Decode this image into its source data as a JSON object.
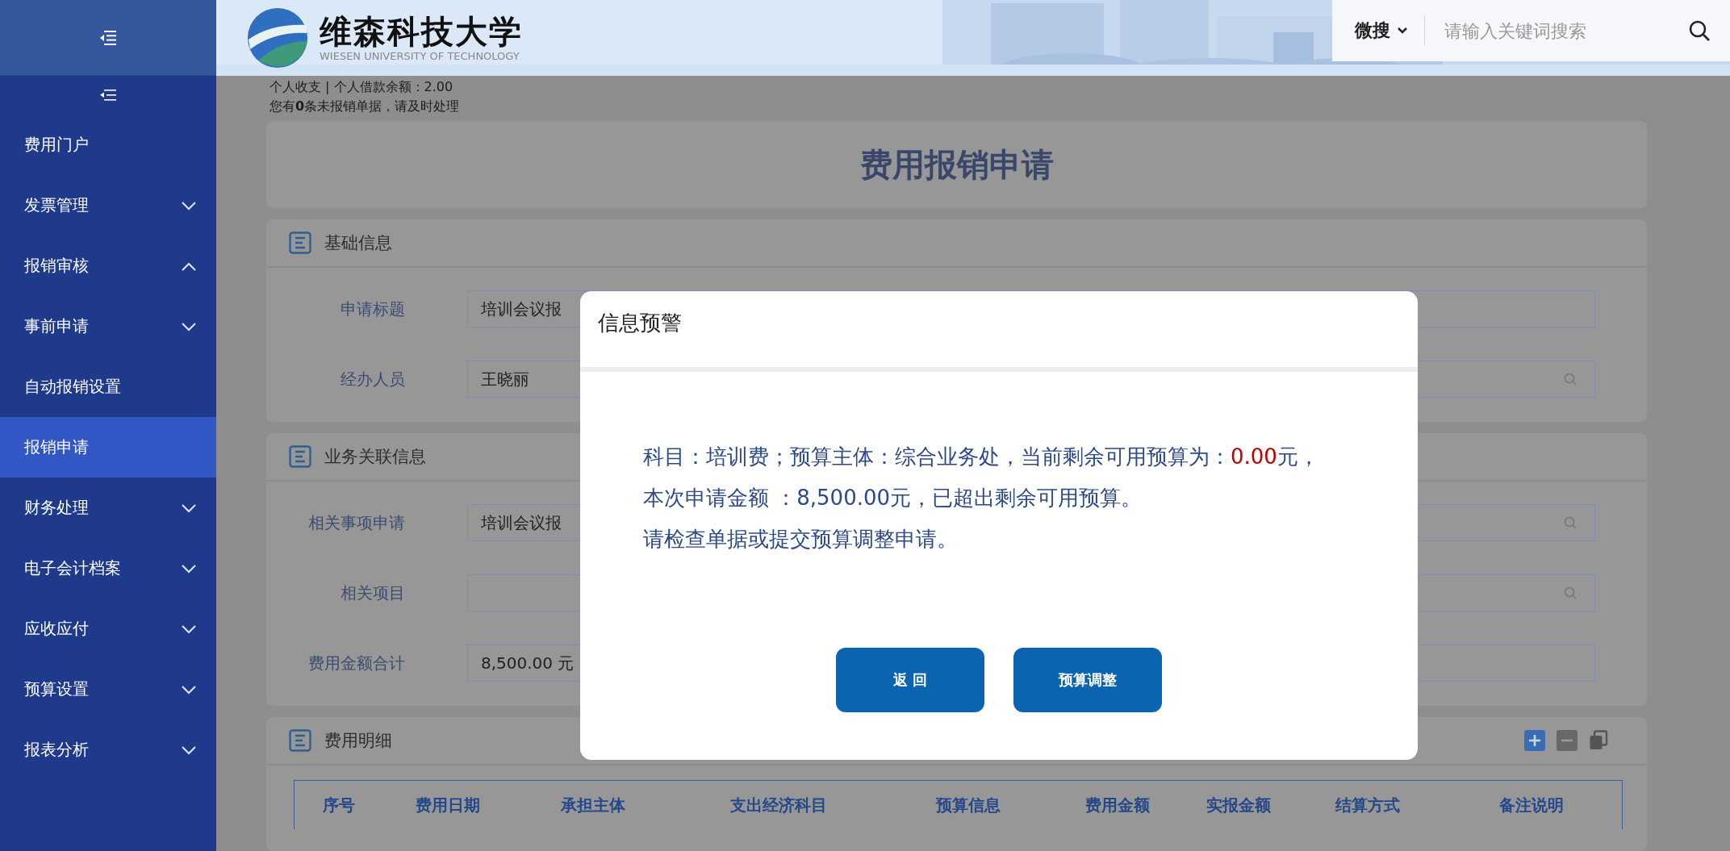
{
  "header": {
    "school_name": "维森科技大学",
    "school_name_en": "WIESEN UNIVERSITY OF TECHNOLOGY",
    "search": {
      "scope": "微搜",
      "placeholder": "请输入关键词搜索"
    }
  },
  "sidebar": {
    "items": [
      {
        "label": "费用门户",
        "kind": "link",
        "selected": false
      },
      {
        "label": "发票管理",
        "kind": "group",
        "expanded": false,
        "selected": false
      },
      {
        "label": "报销审核",
        "kind": "group",
        "expanded": true,
        "selected": false
      },
      {
        "label": "事前申请",
        "kind": "group",
        "expanded": false,
        "selected": false
      },
      {
        "label": "自动报销设置",
        "kind": "link",
        "selected": false
      },
      {
        "label": "报销申请",
        "kind": "link",
        "selected": true
      },
      {
        "label": "财务处理",
        "kind": "group",
        "expanded": false,
        "selected": false
      },
      {
        "label": "电子会计档案",
        "kind": "group",
        "expanded": false,
        "selected": false
      },
      {
        "label": "应收应付",
        "kind": "group",
        "expanded": false,
        "selected": false
      },
      {
        "label": "预算设置",
        "kind": "group",
        "expanded": false,
        "selected": false
      },
      {
        "label": "报表分析",
        "kind": "group",
        "expanded": false,
        "selected": false
      }
    ]
  },
  "notice": [
    "个人收支 | 个人借款余额：2.00",
    "您有**0**条未报销单据，请及时处理"
  ],
  "page_title": "费用报销申请",
  "sections": [
    {
      "title": "基础信息",
      "fields": [
        {
          "label": "申请标题",
          "value": "培训会议报",
          "kind": "text"
        },
        {
          "label": "经办人员",
          "value": "王晓丽",
          "kind": "lookup"
        }
      ]
    },
    {
      "title": "业务关联信息",
      "fields": [
        {
          "label": "相关事项申请",
          "value": "培训会议报",
          "kind": "lookup"
        },
        {
          "label": "相关项目",
          "kind": "lookup"
        },
        {
          "label": "费用金额合计",
          "value": "8,500.00 元",
          "kind": "text"
        }
      ]
    }
  ],
  "details": {
    "title": "费用明细",
    "columns": [
      "序号",
      "费用日期",
      "承担主体",
      "支出经济科目",
      "预算信息",
      "费用金额",
      "实报金额",
      "结算方式",
      "备注说明"
    ]
  },
  "dialog": {
    "title": "信息预警",
    "message": [
      [
        {
          "text": "科目：培训费；预算主体：综合业务处，当前剩余可用预算为：",
          "kind": "normal"
        },
        {
          "text": "0.00",
          "kind": "alert"
        },
        {
          "text": "元，",
          "kind": "normal"
        }
      ],
      [
        {
          "text": "本次申请金额 ：8,500.00元，已超出剩余可用预算。",
          "kind": "normal"
        }
      ],
      [
        {
          "text": "请检查单据或提交预算调整申请。",
          "kind": "normal"
        }
      ]
    ],
    "buttons": [
      "返 回",
      "预算调整"
    ]
  }
}
